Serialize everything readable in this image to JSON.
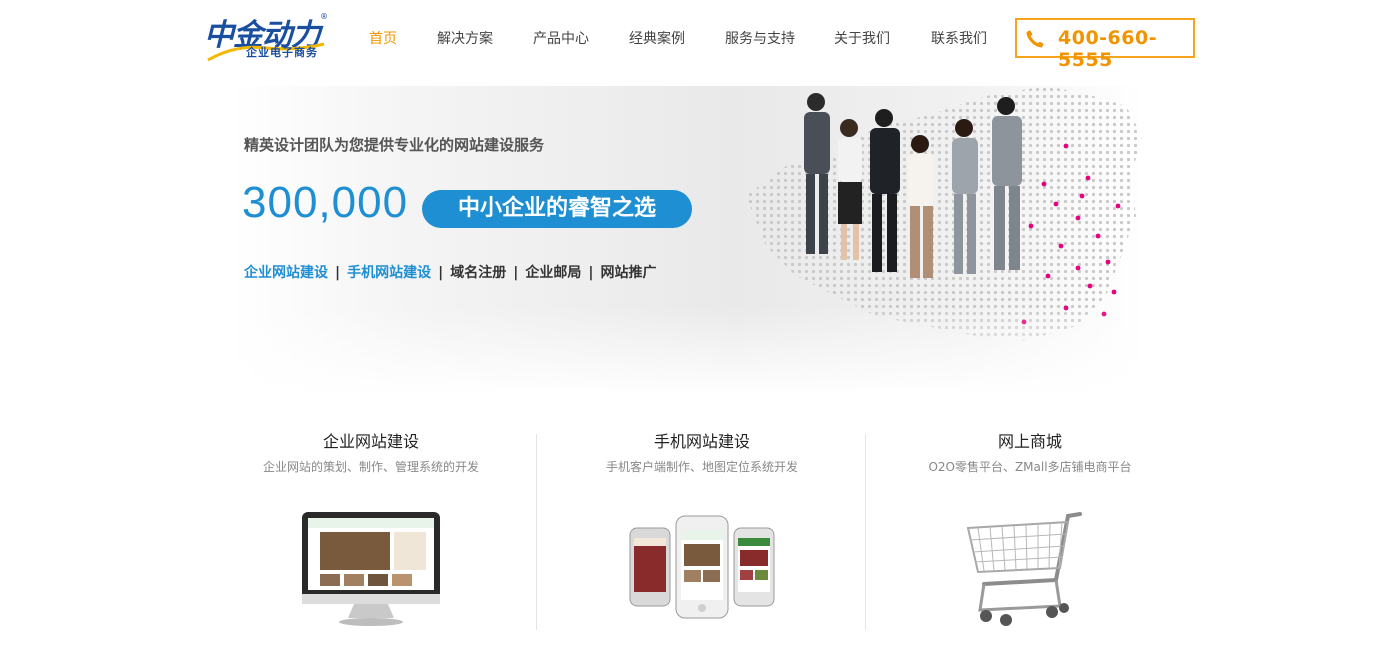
{
  "logo": {
    "script_text": "中金动力",
    "sub_text": "企业电子商务",
    "reg_mark": "®"
  },
  "nav": {
    "items": [
      {
        "label": "首页",
        "active": true
      },
      {
        "label": "解决方案",
        "active": false
      },
      {
        "label": "产品中心",
        "active": false
      },
      {
        "label": "经典案例",
        "active": false
      },
      {
        "label": "服务与支持",
        "active": false
      },
      {
        "label": "关于我们",
        "active": false
      },
      {
        "label": "联系我们",
        "active": false
      }
    ]
  },
  "phone": {
    "icon": "phone-icon",
    "number": "400-660-5555"
  },
  "banner": {
    "tagline": "精英设计团队为您提供专业化的网站建设服务",
    "number": "300,000",
    "pill": "中小企业的睿智之选",
    "links": [
      {
        "label": "企业网站建设",
        "highlight": true
      },
      {
        "label": "手机网站建设",
        "highlight": true
      },
      {
        "label": "域名注册",
        "highlight": false
      },
      {
        "label": "企业邮局",
        "highlight": false
      },
      {
        "label": "网站推广",
        "highlight": false
      }
    ],
    "separator": "|"
  },
  "services": [
    {
      "title": "企业网站建设",
      "desc": "企业网站的策划、制作、管理系统的开发",
      "icon": "desktop-monitor-icon"
    },
    {
      "title": "手机网站建设",
      "desc": "手机客户端制作、地图定位系统开发",
      "icon": "smartphones-icon"
    },
    {
      "title": "网上商城",
      "desc": "O2O零售平台、ZMall多店铺电商平台",
      "icon": "shopping-cart-icon"
    }
  ],
  "colors": {
    "accent_orange": "#f29400",
    "phone_border": "#f5a41b",
    "brand_blue": "#1e8fd3",
    "logo_blue": "#1a4fa0"
  }
}
